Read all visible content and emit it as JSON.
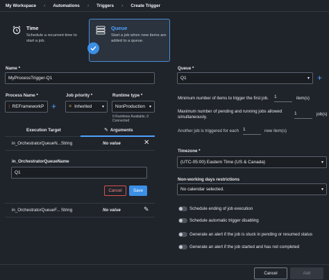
{
  "breadcrumb": [
    "My Workspace",
    "Automations",
    "Triggers",
    "Create Trigger"
  ],
  "trigger_types": {
    "time": {
      "title": "Time",
      "desc1": "Schedule a recurrent time to",
      "desc2": "start a job."
    },
    "queue": {
      "title": "Queue",
      "desc1": "Start a job when new items are",
      "desc2": "added to a queue."
    }
  },
  "name": {
    "label": "Name *",
    "value": "MyProcessTrigger-Q1"
  },
  "process": {
    "label": "Process Name *",
    "value": "REFrameworkP"
  },
  "priority": {
    "label": "Job priority *",
    "value": "Inherited"
  },
  "runtime": {
    "label": "Runtime type *",
    "value": "NonProduction",
    "hint1": "0 Runtimes Available, 0",
    "hint2": "Connected"
  },
  "tabs": {
    "execution_target": "Execution Target",
    "arguments": "Arguments"
  },
  "arg1": {
    "name": "in_OrchestratorQueueN...",
    "type": "String",
    "value": "No value"
  },
  "arg_edit": {
    "label": "in_OrchestratorQueueName",
    "value": "Q1",
    "cancel": "Cancel",
    "save": "Save"
  },
  "arg2": {
    "name": "in_OrchestratorQueueF...",
    "type": "String",
    "value": "No value"
  },
  "queue": {
    "label": "Queue *",
    "value": "Q1"
  },
  "min_items": {
    "label": "Minimum number of items to trigger the first job.",
    "value": "1",
    "unit": "item(s)"
  },
  "max_jobs": {
    "label1": "Maximum number of pending and running jobs allowed",
    "label2": "simultaneously.",
    "value": "1",
    "unit": "job(s)"
  },
  "another_job": {
    "label": "Another job is triggered for each",
    "value": "1",
    "unit": "new item(s)"
  },
  "timezone": {
    "label": "Timezone *",
    "value": "(UTC-05:00) Eastern Time (US & Canada)"
  },
  "non_working": {
    "label": "Non-working days restrictions",
    "value": "No calendar selected."
  },
  "toggles": [
    "Schedule ending of job execution",
    "Schedule automatic trigger disabling",
    "Generate an alert if the job is stuck in pending or resumed status",
    "Generate an alert if the job started and has not completed"
  ],
  "footer": {
    "cancel": "Cancel",
    "add": "Add"
  },
  "colors": {
    "accent": "#3b8fe6",
    "background": "#1f232a",
    "danger": "#d9534f"
  }
}
